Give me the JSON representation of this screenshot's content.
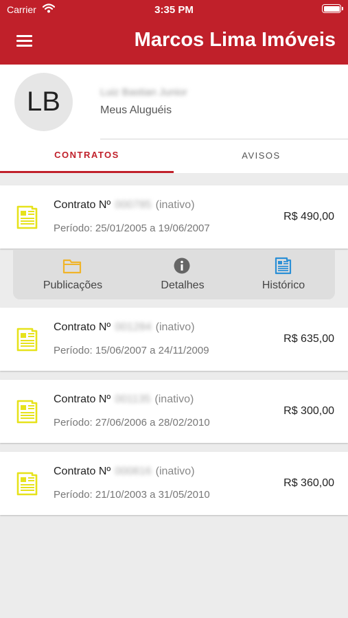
{
  "status_bar": {
    "carrier": "Carrier",
    "time": "3:35 PM"
  },
  "header": {
    "title": "Marcos Lima Imóveis"
  },
  "profile": {
    "initials": "LB",
    "name": "Luiz Bastian Junior",
    "subtitle": "Meus Aluguéis"
  },
  "tabs": [
    {
      "label": "CONTRATOS"
    },
    {
      "label": "AVISOS"
    }
  ],
  "contracts": [
    {
      "label": "Contrato Nº",
      "number": "000785",
      "status": "(inativo)",
      "period": "Período: 25/01/2005 a 19/06/2007",
      "price": "R$ 490,00"
    },
    {
      "label": "Contrato Nº",
      "number": "001284",
      "status": "(inativo)",
      "period": "Período: 15/06/2007 a 24/11/2009",
      "price": "R$ 635,00"
    },
    {
      "label": "Contrato Nº",
      "number": "001135",
      "status": "(inativo)",
      "period": "Período: 27/06/2006 a 28/02/2010",
      "price": "R$ 300,00"
    },
    {
      "label": "Contrato Nº",
      "number": "000816",
      "status": "(inativo)",
      "period": "Período: 21/10/2003 a 31/05/2010",
      "price": "R$ 360,00"
    }
  ],
  "actions": [
    {
      "label": "Publicações"
    },
    {
      "label": "Detalhes"
    },
    {
      "label": "Histórico"
    }
  ],
  "colors": {
    "brand": "#c0202a",
    "doc_icon": "#e6e21a",
    "folder_icon": "#f0b429",
    "info_icon": "#666666",
    "history_icon": "#2a8fd6"
  },
  "icons": {
    "menu": "menu-icon",
    "contract": "document-icon",
    "publications": "folder-icon",
    "details": "info-icon",
    "history": "newspaper-icon"
  }
}
